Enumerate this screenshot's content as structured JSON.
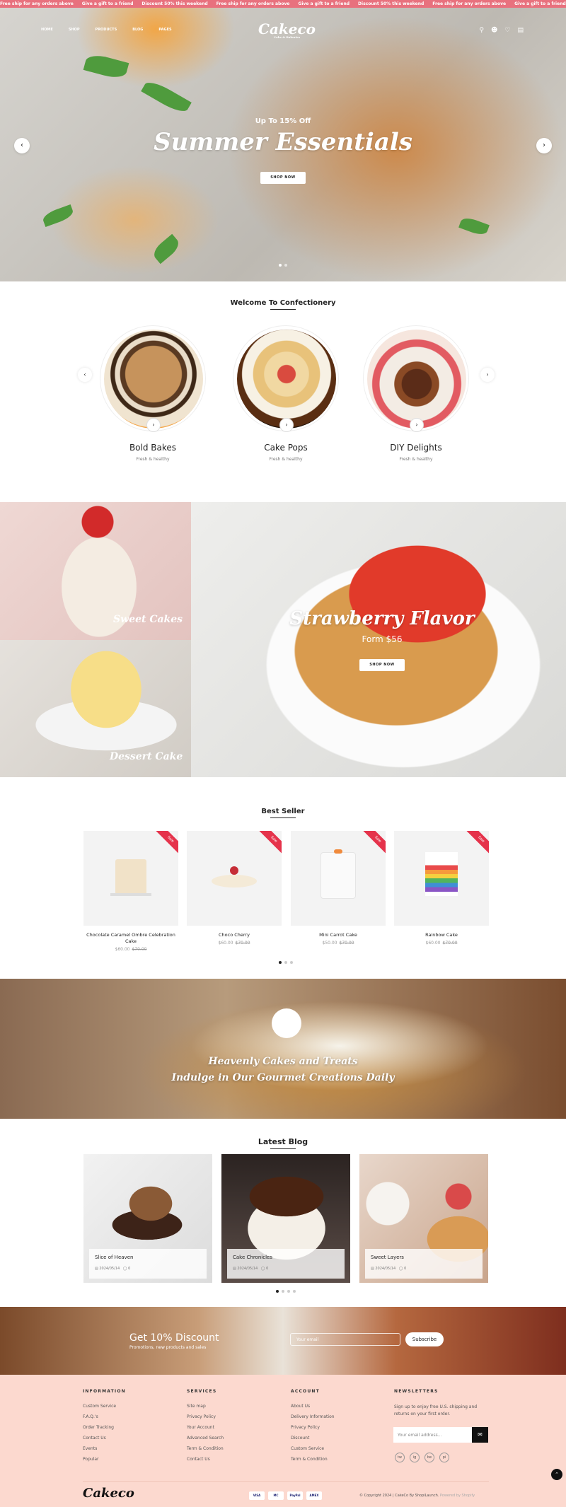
{
  "announcement": [
    "Free ship for any orders above",
    "Give a gift to a friend",
    "Discount 50% this weekend",
    "Free ship for any orders above",
    "Give a gift to a friend",
    "Discount 50% this weekend",
    "Free ship for any orders above",
    "Give a gift to a friend",
    "Discount 50% this weekend",
    "Free ship for any orders above",
    "Give a gift to a friend",
    "Discount 50% this weekend"
  ],
  "nav": {
    "menu": [
      "HOME",
      "SHOP",
      "PRODUCTS",
      "BLOG",
      "PAGES"
    ],
    "logo": "Cakeco",
    "logo_sub": "Cake & Bakeries"
  },
  "hero": {
    "sub": "Up To 15% Off",
    "title": "Summer Essentials",
    "button": "SHOP NOW"
  },
  "welcome": {
    "title": "Welcome To Confectionery",
    "items": [
      {
        "title": "Bold Bakes",
        "sub": "Fresh & healthy"
      },
      {
        "title": "Cake Pops",
        "sub": "Fresh & healthy"
      },
      {
        "title": "DIY Delights",
        "sub": "Fresh & healthy"
      }
    ]
  },
  "banners": {
    "left_top": "Sweet Cakes",
    "left_bottom": "Dessert Cake",
    "main_title": "Strawberry Flavor",
    "main_sub": "Form $56",
    "main_button": "SHOP NOW"
  },
  "bestseller": {
    "title": "Best Seller",
    "badge": "Sale",
    "products": [
      {
        "name": "Chocolate Caramel Ombre Celebration Cake",
        "price": "$60.00",
        "old": "$70.00"
      },
      {
        "name": "Choco Cherry",
        "price": "$60.00",
        "old": "$70.00"
      },
      {
        "name": "Mini Carrot Cake",
        "price": "$50.00",
        "old": "$70.00"
      },
      {
        "name": "Rainbow Cake",
        "price": "$60.00",
        "old": "$70.00"
      }
    ]
  },
  "parallax": {
    "line1": "Heavenly Cakes and Treats",
    "line2": "Indulge in Our Gourmet Creations Daily"
  },
  "blog": {
    "title": "Latest Blog",
    "posts": [
      {
        "title": "Slice of Heaven",
        "date": "2024/05/14",
        "comments": "0"
      },
      {
        "title": "Cake Chronicles",
        "date": "2024/05/14",
        "comments": "0"
      },
      {
        "title": "Sweet Layers",
        "date": "2024/05/14",
        "comments": "0"
      }
    ]
  },
  "newsletter": {
    "title": "Get 10% Discount",
    "sub": "Promotions, new products and sales",
    "placeholder": "Your email",
    "button": "Subscribe"
  },
  "footer": {
    "information": {
      "title": "INFORMATION",
      "items": [
        "Custom Service",
        "F.A.Q.'s",
        "Order Tracking",
        "Contact Us",
        "Events",
        "Popular"
      ]
    },
    "services": {
      "title": "SERVICES",
      "items": [
        "Site map",
        "Privacy Policy",
        "Your Account",
        "Advanced Search",
        "Term & Condition",
        "Contact Us"
      ]
    },
    "account": {
      "title": "ACCOUNT",
      "items": [
        "About Us",
        "Delivery Information",
        "Privacy Policy",
        "Discount",
        "Custom Service",
        "Term & Condition"
      ]
    },
    "newsletters": {
      "title": "NEWSLETTERS",
      "text": "Sign up to enjoy free U.S. shipping and returns on your first order.",
      "placeholder": "Your email address..."
    },
    "social": [
      "tw",
      "ig",
      "be",
      "pi"
    ],
    "logo": "Cakeco",
    "payments": [
      "VISA",
      "MC",
      "PayPal",
      "AMEX"
    ],
    "copyright": "© Copyright 2024 | CakeCo By ShopiLaunch.",
    "powered": "Powered by Shopify"
  }
}
